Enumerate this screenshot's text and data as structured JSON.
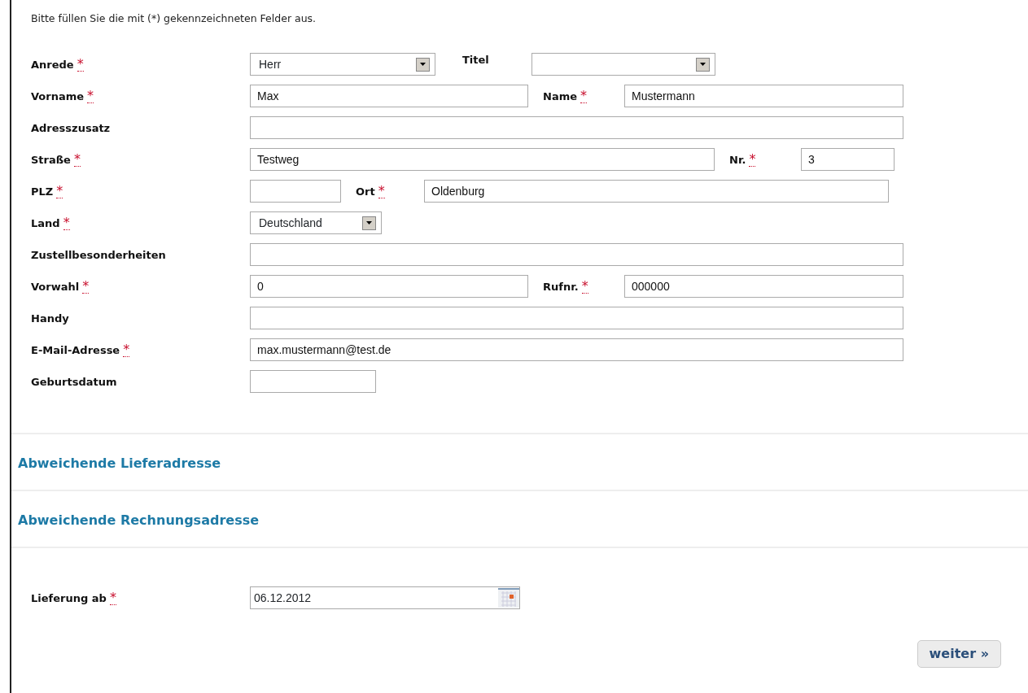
{
  "intro": "Bitte füllen Sie die mit (*) gekennzeichneten Felder aus.",
  "rows": [
    {
      "fields": [
        {
          "label": "Anrede",
          "marker": "*",
          "kind": "select",
          "value": "Herr"
        },
        {
          "label": "Titel",
          "kind": "select"
        }
      ]
    },
    {
      "fields": [
        {
          "label": "Vorname",
          "marker": "*",
          "kind": "text",
          "value": "Max"
        },
        {
          "label": "Name",
          "marker": "*",
          "kind": "text",
          "value": "Mustermann"
        }
      ]
    },
    {
      "fields": [
        {
          "label": "Adresszusatz",
          "kind": "text"
        }
      ]
    },
    {
      "fields": [
        {
          "label": "Straße",
          "marker": "*",
          "kind": "text",
          "value": "Testweg"
        },
        {
          "label": "Nr.",
          "marker": "*",
          "kind": "text",
          "value": "3"
        }
      ]
    },
    {
      "fields": [
        {
          "label": "PLZ",
          "marker": "*",
          "kind": "text"
        },
        {
          "label": "Ort",
          "marker": "*",
          "kind": "text",
          "value": "Oldenburg"
        }
      ]
    },
    {
      "fields": [
        {
          "label": "Land",
          "marker": "*",
          "kind": "select",
          "value": "Deutschland"
        }
      ]
    },
    {
      "fields": [
        {
          "label": "Zustellbesonderheiten",
          "kind": "text"
        }
      ]
    },
    {
      "fields": [
        {
          "label": "Vorwahl",
          "marker": "*",
          "kind": "text",
          "value": "0"
        },
        {
          "label": "Rufnr.",
          "marker": "*",
          "kind": "text",
          "value": "000000"
        }
      ]
    },
    {
      "fields": [
        {
          "label": "Handy",
          "kind": "text"
        }
      ]
    },
    {
      "fields": [
        {
          "label": "E-Mail-Adresse",
          "marker": "*",
          "kind": "text",
          "value": "max.mustermann@test.de"
        }
      ]
    },
    {
      "fields": [
        {
          "label": "Geburtsdatum",
          "kind": "text"
        }
      ]
    }
  ],
  "sections": [
    "Abweichende Lieferadresse",
    "Abweichende Rechnungsadresse"
  ],
  "delivery": {
    "label": "Lieferung ab",
    "marker": "*",
    "kind": "date",
    "value": "06.12.2012"
  },
  "button": "weiter »"
}
